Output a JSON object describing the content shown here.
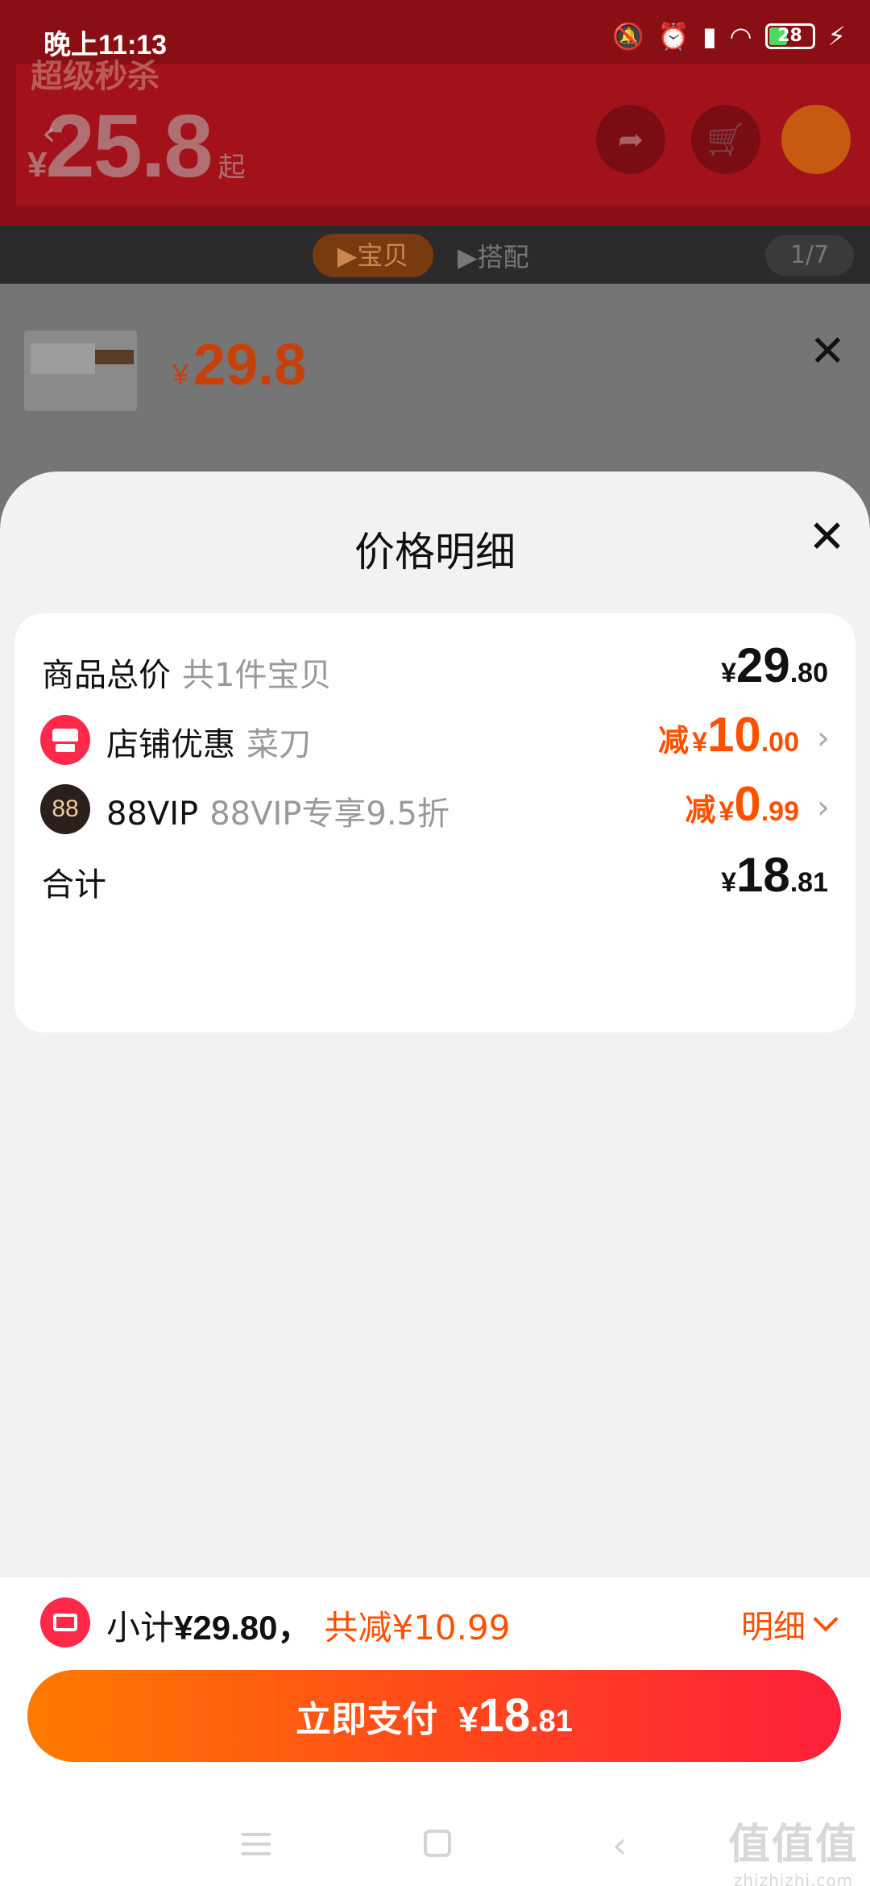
{
  "status_bar": {
    "time": "晚上11:13",
    "battery": "28"
  },
  "background_page": {
    "hero_title": "超级秒杀",
    "hero_price_yen": "¥",
    "hero_price": "25.8",
    "hero_price_suffix": "起",
    "tab_active": "▶宝贝",
    "tab_other": "▶搭配",
    "image_counter": "1/7",
    "sku_price_yen": "¥",
    "sku_price": "29.8"
  },
  "sheet": {
    "title": "价格明细",
    "rows": [
      {
        "label": "商品总价",
        "sub": "共1件宝贝",
        "prefix": "",
        "yen": "¥",
        "amount_int": "29",
        "amount_dec": ".80"
      },
      {
        "label": "店铺优惠",
        "sub": "菜刀",
        "prefix": "减",
        "yen": "¥",
        "amount_int": "10",
        "amount_dec": ".00"
      },
      {
        "label": "88VIP",
        "sub": "88VIP专享9.5折",
        "prefix": "减",
        "yen": "¥",
        "amount_int": "0",
        "amount_dec": ".99",
        "icon_text": "88"
      },
      {
        "label": "合计",
        "sub": "",
        "prefix": "",
        "yen": "¥",
        "amount_int": "18",
        "amount_dec": ".81"
      }
    ]
  },
  "footer": {
    "subtotal_label": "小计",
    "subtotal_value": "¥29.80，",
    "saved_text": "共减¥10.99",
    "detail_label": "明细",
    "pay_label": "立即支付",
    "pay_yen": "¥",
    "pay_int": "18",
    "pay_dec": ".81"
  },
  "watermark": {
    "logo": "值值值",
    "site": "zhizhizhi.com"
  },
  "colors": {
    "accent": "#ff5000",
    "brand_red": "#ff2a4a",
    "sheet_bg": "#f2f2f2"
  },
  "icons": [
    "mute-icon",
    "alarm-icon",
    "signal-icon",
    "wifi-icon",
    "battery-icon",
    "charging-icon",
    "close-icon",
    "shop-icon",
    "vip-icon",
    "chevron-right-icon",
    "ticket-icon",
    "chevron-down-icon"
  ]
}
